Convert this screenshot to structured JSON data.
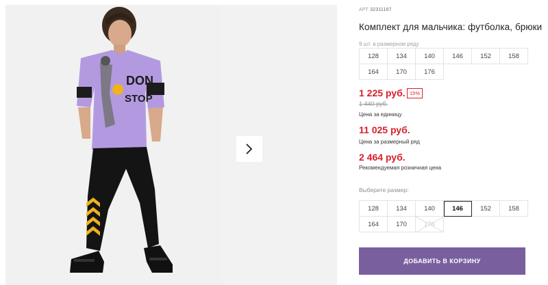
{
  "product": {
    "art_label": "АРТ",
    "art_value": "32311167",
    "title": "Комплект для мальчика: футболка, брюки"
  },
  "size_row": {
    "note": "9 шт. в размерном ряду",
    "sizes": [
      "128",
      "134",
      "140",
      "146",
      "152",
      "158",
      "164",
      "170",
      "176"
    ]
  },
  "prices": {
    "unit_price": "1 225 руб.",
    "discount_badge": "15%",
    "old_price": "1 440 руб.",
    "unit_caption": "Цена за единицу",
    "row_price": "11 025 руб.",
    "row_caption": "Цена за размерный ряд",
    "retail_price": "2 464 руб.",
    "retail_caption": "Рекомендуемая розничная цена"
  },
  "size_picker": {
    "label": "Выберите размер:",
    "sizes": [
      "128",
      "134",
      "140",
      "146",
      "152",
      "158",
      "164",
      "170",
      "176"
    ],
    "selected": "146",
    "unavailable": [
      "176"
    ]
  },
  "cart_button": {
    "label": "ДОБАВИТЬ В КОРЗИНУ"
  },
  "gallery": {
    "shirt_print_line1": "DON",
    "shirt_print_line2": "STOP",
    "next_icon": "chevron-right-icon"
  },
  "colors": {
    "price_red": "#d81e2b",
    "cart_purple": "#7a5f9e",
    "shirt_lilac": "#b39ae0",
    "chevron_yellow": "#f0b21d"
  }
}
